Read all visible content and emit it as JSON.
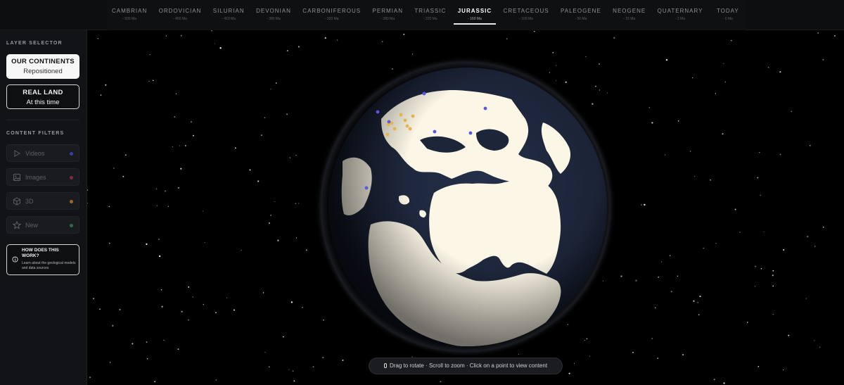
{
  "periods": [
    {
      "name": "CAMBRIAN",
      "age": "- 500 Ma",
      "active": false
    },
    {
      "name": "ORDOVICIAN",
      "age": "- 450 Ma",
      "active": false
    },
    {
      "name": "SILURIAN",
      "age": "- 410 Ma",
      "active": false
    },
    {
      "name": "DEVONIAN",
      "age": "- 380 Ma",
      "active": false
    },
    {
      "name": "CARBONIFEROUS",
      "age": "- 320 Ma",
      "active": false
    },
    {
      "name": "PERMIAN",
      "age": "- 280 Ma",
      "active": false
    },
    {
      "name": "TRIASSIC",
      "age": "- 220 Ma",
      "active": false
    },
    {
      "name": "JURASSIC",
      "age": "- 160 Ma",
      "active": true
    },
    {
      "name": "CRETACEOUS",
      "age": "- 100 Ma",
      "active": false
    },
    {
      "name": "PALEOGENE",
      "age": "- 50 Ma",
      "active": false
    },
    {
      "name": "NEOGENE",
      "age": "- 15 Ma",
      "active": false
    },
    {
      "name": "QUATERNARY",
      "age": "- 2 Ma",
      "active": false
    },
    {
      "name": "TODAY",
      "age": "- 0 Ma",
      "active": false
    }
  ],
  "sidebar": {
    "layer_title": "LAYER SELECTOR",
    "layers": [
      {
        "line1": "OUR CONTINENTS",
        "line2": "Repositioned",
        "selected": true
      },
      {
        "line1": "REAL LAND",
        "line2": "At this time",
        "selected": false
      }
    ],
    "filters_title": "CONTENT FILTERS",
    "filters": [
      {
        "label": "Videos",
        "icon": "play-icon",
        "color": "#3b3f9e"
      },
      {
        "label": "Images",
        "icon": "image-icon",
        "color": "#7a2f3a"
      },
      {
        "label": "3D",
        "icon": "cube-icon",
        "color": "#9a6a2c"
      },
      {
        "label": "New",
        "icon": "star-icon",
        "color": "#2d6a4c"
      }
    ],
    "how": {
      "title": "HOW DOES THIS WORK?",
      "desc": "Learn about the geological models and data sources",
      "icon": "info-icon"
    }
  },
  "hint": {
    "text": "Drag to rotate · Scroll to zoom · Click on a point to view content",
    "icon": "mouse-icon"
  },
  "colors": {
    "land": "#fbf6e6",
    "ocean": "#1d2638",
    "point_blue": "#5b55e0",
    "point_yellow": "#e5b34a"
  }
}
